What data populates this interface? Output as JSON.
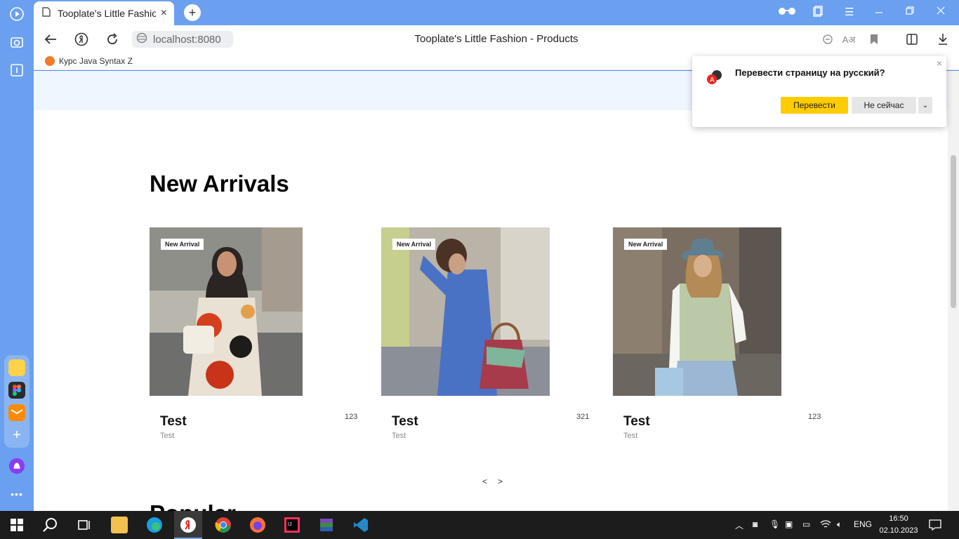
{
  "browser": {
    "tab_title": "Tooplate's Little Fashion",
    "new_tab": "+",
    "url": "localhost:8080",
    "page_title": "Tooplate's Little Fashion - Products",
    "bookmark": "Курс Java Syntax Z"
  },
  "translate_popup": {
    "question": "Перевести страницу на русский?",
    "translate_label": "Перевести",
    "not_now_label": "Не сейчас",
    "more_label": "⌄",
    "close": "×"
  },
  "page": {
    "section_title": "New Arrivals",
    "next_section_title": "Popular",
    "products": [
      {
        "badge": "New Arrival",
        "name": "Test",
        "description": "Test",
        "price": "123"
      },
      {
        "badge": "New Arrival",
        "name": "Test",
        "description": "Test",
        "price": "321"
      },
      {
        "badge": "New Arrival",
        "name": "Test",
        "description": "Test",
        "price": "123"
      }
    ],
    "prev_label": "<",
    "next_label": ">"
  },
  "taskbar": {
    "language": "ENG",
    "time": "16:50",
    "date": "02.10.2023"
  },
  "colors": {
    "accent_yellow": "#ffcc00",
    "browser_blue": "#6aa0ef"
  }
}
